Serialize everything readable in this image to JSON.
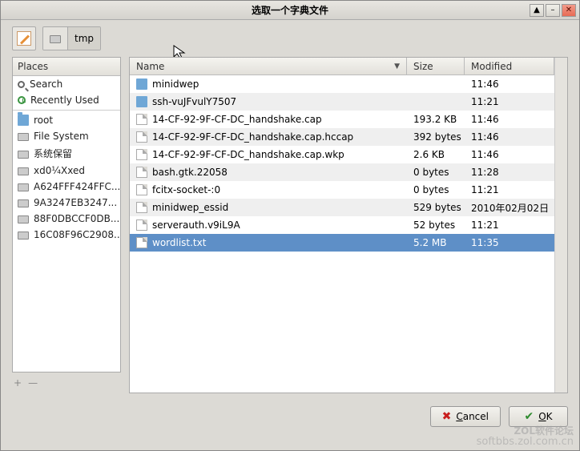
{
  "window": {
    "title": "选取一个字典文件"
  },
  "toolbar": {
    "path_root_icon": "hd-icon",
    "path_segment": "tmp"
  },
  "sidebar": {
    "header": "Places",
    "search": "Search",
    "recent": "Recently Used",
    "items": [
      {
        "label": "root",
        "icon": "folder"
      },
      {
        "label": "File System",
        "icon": "hd"
      },
      {
        "label": "系统保留",
        "icon": "hd"
      },
      {
        "label": "xd0¼Xxed",
        "icon": "hd"
      },
      {
        "label": "A624FFF424FFC...",
        "icon": "hd"
      },
      {
        "label": "9A3247EB3247...",
        "icon": "hd"
      },
      {
        "label": "88F0DBCCF0DB...",
        "icon": "hd"
      },
      {
        "label": "16C08F96C2908...",
        "icon": "hd"
      }
    ],
    "add": "+",
    "remove": "—"
  },
  "columns": {
    "name": "Name",
    "size": "Size",
    "modified": "Modified"
  },
  "files": [
    {
      "name": "minidwep",
      "icon": "folder",
      "size": "",
      "modified": "11:46"
    },
    {
      "name": "ssh-vuJFvulY7507",
      "icon": "folder",
      "size": "",
      "modified": "11:21"
    },
    {
      "name": "14-CF-92-9F-CF-DC_handshake.cap",
      "icon": "file",
      "size": "193.2 KB",
      "modified": "11:46"
    },
    {
      "name": "14-CF-92-9F-CF-DC_handshake.cap.hccap",
      "icon": "file",
      "size": "392 bytes",
      "modified": "11:46"
    },
    {
      "name": "14-CF-92-9F-CF-DC_handshake.cap.wkp",
      "icon": "file",
      "size": "2.6 KB",
      "modified": "11:46"
    },
    {
      "name": "bash.gtk.22058",
      "icon": "file",
      "size": "0 bytes",
      "modified": "11:28"
    },
    {
      "name": "fcitx-socket-:0",
      "icon": "file",
      "size": "0 bytes",
      "modified": "11:21"
    },
    {
      "name": "minidwep_essid",
      "icon": "file",
      "size": "529 bytes",
      "modified": "2010年02月02日"
    },
    {
      "name": "serverauth.v9iL9A",
      "icon": "file",
      "size": "52 bytes",
      "modified": "11:21"
    },
    {
      "name": "wordlist.txt",
      "icon": "file",
      "size": "5.2 MB",
      "modified": "11:35",
      "selected": true
    }
  ],
  "buttons": {
    "cancel": "Cancel",
    "ok": "OK"
  },
  "watermark": {
    "line1": "ZOL软件论坛",
    "line2": "softbbs.zol.com.cn"
  }
}
